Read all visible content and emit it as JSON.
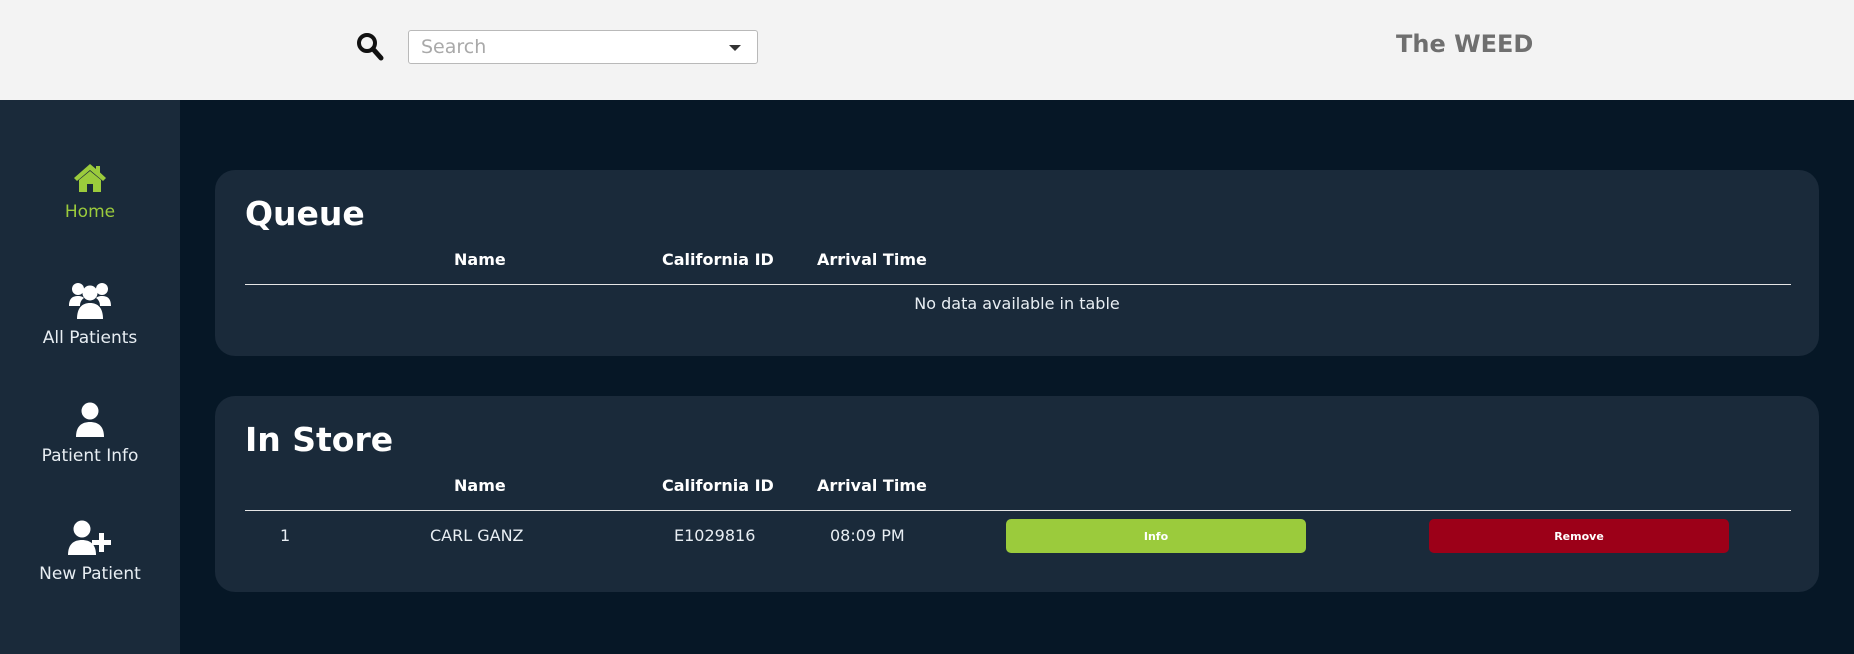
{
  "header": {
    "search_placeholder": "Search",
    "brand": "The WEED"
  },
  "sidebar": {
    "items": [
      {
        "label": "Home",
        "icon": "home-icon",
        "active": true
      },
      {
        "label": "All Patients",
        "icon": "users-icon",
        "active": false
      },
      {
        "label": "Patient Info",
        "icon": "user-icon",
        "active": false
      },
      {
        "label": "New Patient",
        "icon": "user-plus-icon",
        "active": false
      }
    ]
  },
  "queue": {
    "title": "Queue",
    "columns": [
      "Name",
      "California ID",
      "Arrival Time"
    ],
    "empty_text": "No data available in table"
  },
  "in_store": {
    "title": "In Store",
    "columns": [
      "Name",
      "California ID",
      "Arrival Time"
    ],
    "rows": [
      {
        "index": "1",
        "name": "CARL GANZ",
        "california_id": "E1029816",
        "arrival_time": "08:09 PM",
        "info_label": "Info",
        "remove_label": "Remove"
      }
    ]
  },
  "colors": {
    "accent_green": "#9bcb3c",
    "remove_red": "#9c0018",
    "sidebar_bg": "#1a2a3a",
    "content_bg": "#061726"
  }
}
